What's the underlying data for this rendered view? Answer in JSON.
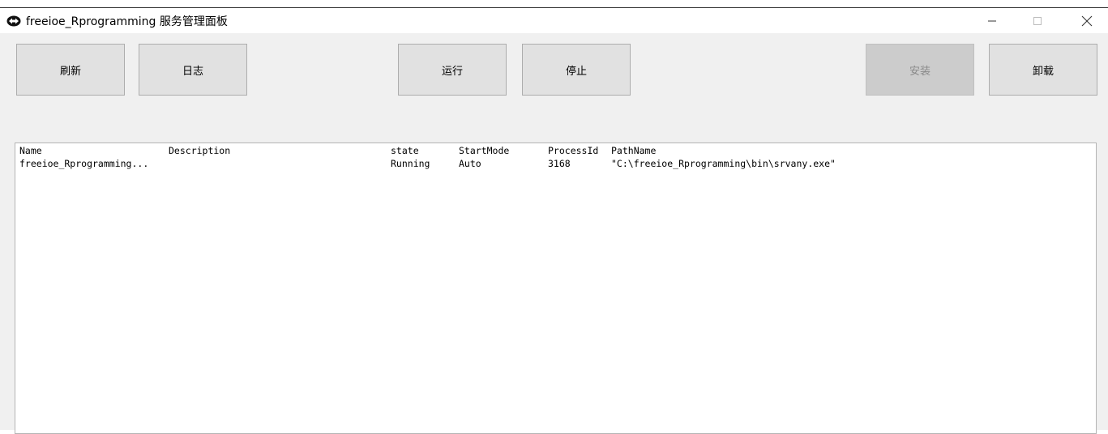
{
  "window": {
    "title": "freeioe_Rprogramming 服务管理面板",
    "minimize_glyph": "—",
    "maximize_glyph": "☐",
    "close_glyph": "✕"
  },
  "toolbar": {
    "refresh_label": "刷新",
    "log_label": "日志",
    "run_label": "运行",
    "stop_label": "停止",
    "install_label": "安装",
    "uninstall_label": "卸载"
  },
  "table": {
    "columns": [
      "Name",
      "Description",
      "state",
      "StartMode",
      "ProcessId",
      "PathName"
    ],
    "rows": [
      [
        "freeioe_Rprogramming...",
        "",
        "Running",
        "Auto",
        "3168",
        "\"C:\\freeioe_Rprogramming\\bin\\srvany.exe\""
      ]
    ]
  },
  "colors": {
    "button_bg": "#e1e1e1",
    "button_disabled_bg": "#cccccc",
    "client_bg": "#f0f0f0"
  },
  "icons": [
    "app-icon",
    "minimize-icon",
    "maximize-icon",
    "close-icon"
  ]
}
